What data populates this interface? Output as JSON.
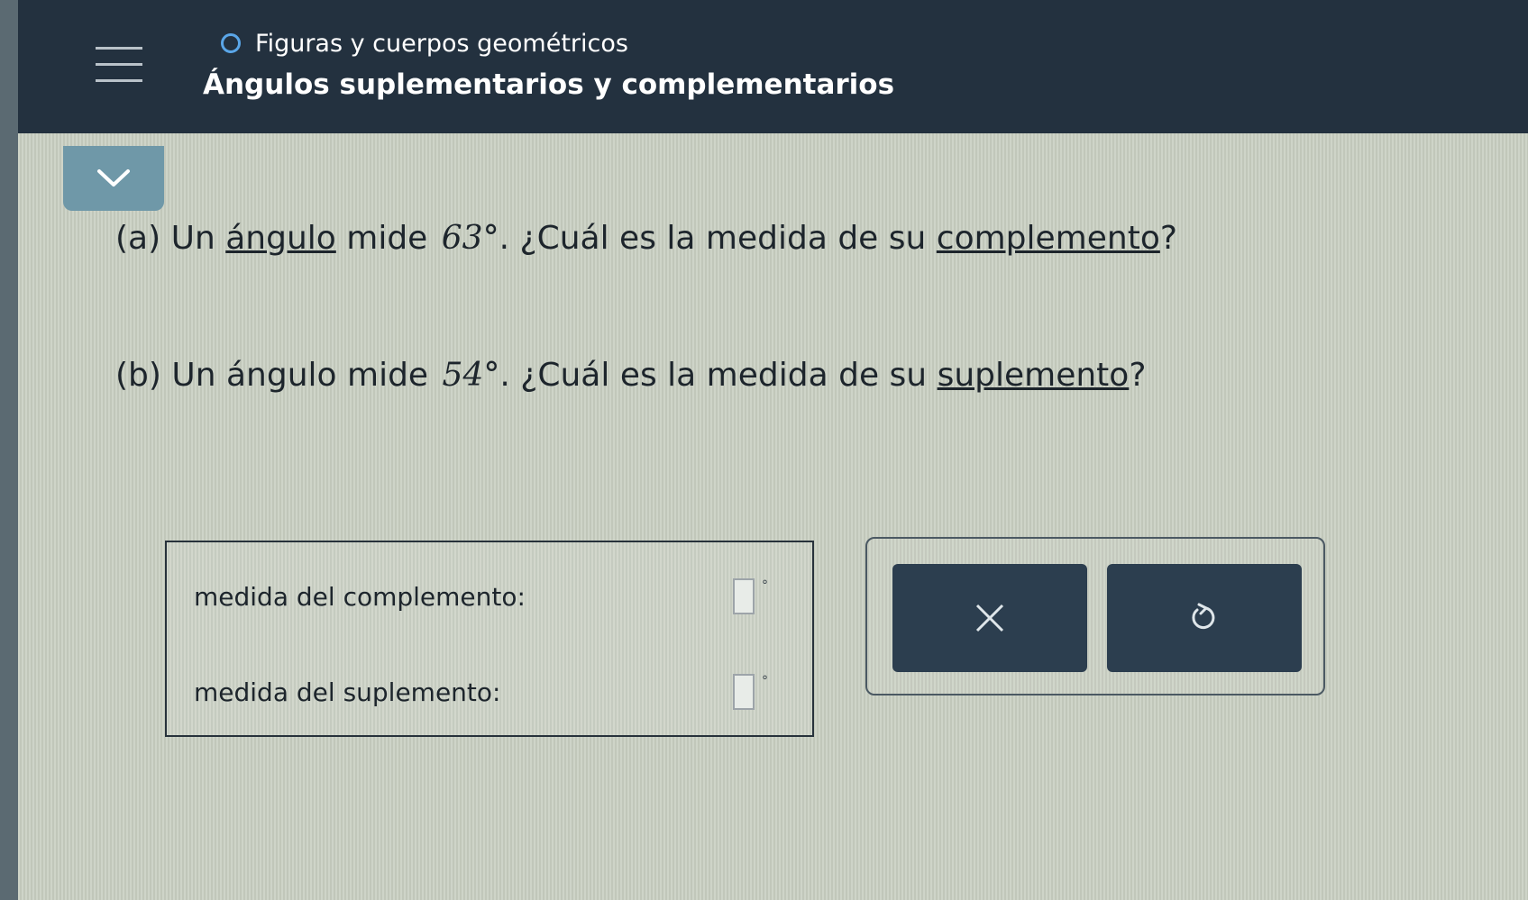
{
  "header": {
    "topic": "Figuras y cuerpos geométricos",
    "title": "Ángulos suplementarios y complementarios",
    "menu_icon": "hamburger-menu-icon",
    "progress_icon": "progress-circle-icon"
  },
  "collapse_icon": "chevron-down-icon",
  "question_a": {
    "prefix": "(a) Un",
    "link1": "ángulo",
    "middle": "mide",
    "value": "63°",
    "text": ". ¿Cuál es la medida de su",
    "link2": "complemento",
    "suffix": "?"
  },
  "question_b": {
    "prefix": "(b) Un ángulo mide",
    "value": "54°",
    "text": ". ¿Cuál es la medida de su",
    "link": "suplemento",
    "suffix": "?"
  },
  "answers": {
    "complement_label": "medida del complemento:",
    "complement_value": "",
    "complement_unit": "°",
    "supplement_label": "medida del suplemento:",
    "supplement_value": "",
    "supplement_unit": "°"
  },
  "buttons": {
    "clear_icon": "close-icon",
    "undo_icon": "undo-icon"
  },
  "colors": {
    "header_bg": "#23313f",
    "accent": "#5aa6e8",
    "button_bg": "#2c3e4f",
    "tab_bg": "#6f98a8",
    "page_bg": "#c9cfc2"
  }
}
